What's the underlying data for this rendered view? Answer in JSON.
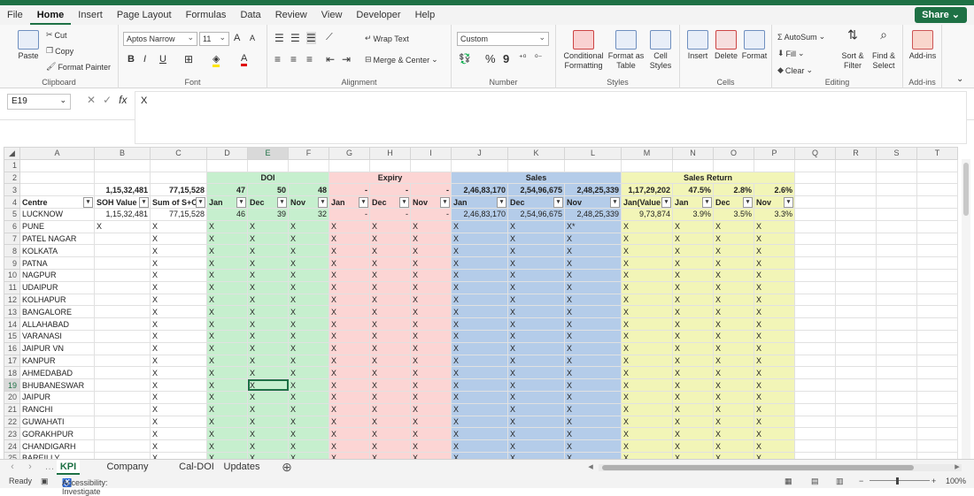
{
  "menu": {
    "items": [
      "File",
      "Home",
      "Insert",
      "Page Layout",
      "Formulas",
      "Data",
      "Review",
      "View",
      "Developer",
      "Help"
    ],
    "share": "Share"
  },
  "ribbon": {
    "clipboard": {
      "paste": "Paste",
      "cut": "Cut",
      "copy": "Copy",
      "format_painter": "Format Painter",
      "label": "Clipboard"
    },
    "font": {
      "name": "Aptos Narrow",
      "size": "11",
      "bold": "B",
      "italic": "I",
      "underline": "U",
      "grow": "A",
      "shrink": "A",
      "label": "Font"
    },
    "alignment": {
      "wrap": "Wrap Text",
      "merge": "Merge & Center",
      "label": "Alignment"
    },
    "number": {
      "format": "Custom",
      "percent": "%",
      "comma": "9",
      "label": "Number"
    },
    "styles": {
      "cond": "Conditional Formatting",
      "table": "Format as Table",
      "cell": "Cell Styles",
      "label": "Styles"
    },
    "cells": {
      "insert": "Insert",
      "delete": "Delete",
      "format": "Format",
      "label": "Cells"
    },
    "editing": {
      "autosum": "AutoSum",
      "fill": "Fill",
      "clear": "Clear",
      "sort": "Sort & Filter",
      "find": "Find & Select",
      "label": "Editing"
    },
    "addins": {
      "addins": "Add-ins",
      "label": "Add-ins"
    }
  },
  "formula_bar": {
    "name_box": "E19",
    "fx": "fx",
    "value": "X"
  },
  "columns": [
    "A",
    "B",
    "C",
    "D",
    "E",
    "F",
    "G",
    "H",
    "I",
    "J",
    "K",
    "L",
    "M",
    "N",
    "O",
    "P",
    "Q",
    "R",
    "S",
    "T"
  ],
  "row2": {
    "doi": "DOI",
    "expiry": "Expiry",
    "sales": "Sales",
    "sales_return": "Sales Return"
  },
  "row3": [
    "",
    "1,15,32,481",
    "77,15,528",
    "47",
    "50",
    "48",
    "-",
    "-",
    "-",
    "2,46,83,170",
    "2,54,96,675",
    "2,48,25,339",
    "1,17,29,202",
    "47.5%",
    "2.8%",
    "2.6%"
  ],
  "row4": [
    "Centre",
    "SOH Value",
    "Sum of S+C",
    "Jan",
    "Dec",
    "Nov",
    "Jan",
    "Dec",
    "Nov",
    "Jan",
    "Dec",
    "Nov",
    "Jan(Value",
    "Jan",
    "Dec",
    "Nov"
  ],
  "row5": [
    "LUCKNOW",
    "1,15,32,481",
    "77,15,528",
    "46",
    "39",
    "32",
    "-",
    "-",
    "-",
    "2,46,83,170",
    "2,54,96,675",
    "2,48,25,339",
    "9,73,874",
    "3.9%",
    "3.5%",
    "3.3%"
  ],
  "centres": [
    "PUNE",
    "PATEL NAGAR",
    "KOLKATA",
    "PATNA",
    "NAGPUR",
    "UDAIPUR",
    "KOLHAPUR",
    "BANGALORE",
    "ALLAHABAD",
    "VARANASI",
    "JAIPUR VN",
    "KANPUR",
    "AHMEDABAD",
    "BHUBANESWAR",
    "JAIPUR",
    "RANCHI",
    "GUWAHATI",
    "GORAKHPUR",
    "CHANDIGARH",
    "BAREILLY"
  ],
  "x_mark": "X",
  "pune_b": "X",
  "pune_l": "X*",
  "sheet_tabs": [
    "KPI",
    "Company Scorecard",
    "Cal-DOI",
    "Updates"
  ],
  "status": {
    "ready": "Ready",
    "accessibility": "Accessibility: Investigate",
    "zoom": "100%"
  },
  "colors": {
    "accent": "#1e7145",
    "doi": "#c6efce",
    "expiry": "#fcd5d4",
    "sales": "#b4cce9",
    "sales_return": "#f2f5b7"
  }
}
